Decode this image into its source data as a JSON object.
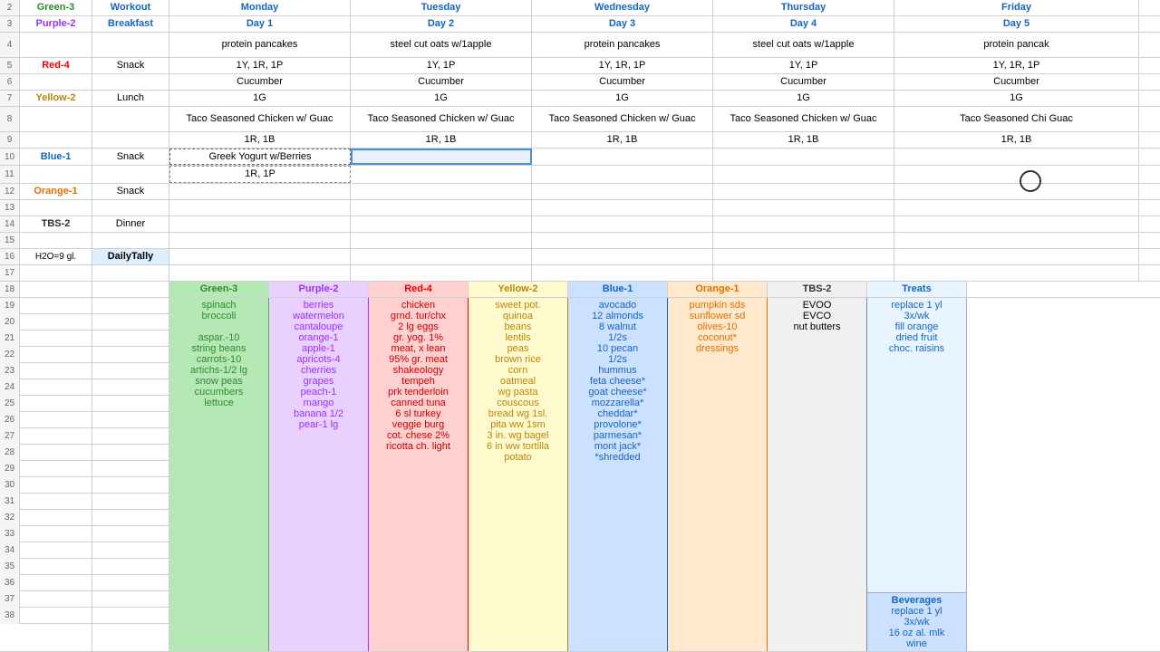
{
  "colors": {
    "green": "#2e8b2e",
    "purple": "#9b30ff",
    "red": "#cc0000",
    "yellow": "#b8860b",
    "blue": "#1565c0",
    "orange": "#e07000"
  },
  "rows": {
    "row2": {
      "num": "2",
      "a": "Green-3",
      "b": "Workout",
      "mon": "Monday",
      "tue": "Tuesday",
      "wed": "Wednesday",
      "thu": "Thursday",
      "fri": "Friday"
    },
    "row3": {
      "num": "3",
      "a": "Purple-2",
      "b": "Breakfast",
      "mon": "Day 1",
      "tue": "Day 2",
      "wed": "Day 3",
      "thu": "Day 4",
      "fri": "Day 5"
    },
    "row4": {
      "num": "4",
      "a": "",
      "b": "",
      "mon": "protein pancakes",
      "tue": "steel cut oats w/1apple",
      "wed": "protein pancakes",
      "thu": "steel cut oats w/1apple",
      "fri": "protein pancak"
    },
    "row5": {
      "num": "5",
      "a": "Red-4",
      "b": "Snack",
      "mon": "1Y, 1R, 1P",
      "tue": "1Y, 1P",
      "wed": "1Y, 1R, 1P",
      "thu": "1Y, 1P",
      "fri": "1Y, 1R, 1P"
    },
    "row6": {
      "num": "6",
      "a": "",
      "b": "",
      "mon": "Cucumber",
      "tue": "Cucumber",
      "wed": "Cucumber",
      "thu": "Cucumber",
      "fri": "Cucumber"
    },
    "row7": {
      "num": "7",
      "a": "Yellow-2",
      "b": "Lunch",
      "mon": "1G",
      "tue": "1G",
      "wed": "1G",
      "thu": "1G",
      "fri": "1G"
    },
    "row8": {
      "num": "8",
      "a": "",
      "b": "",
      "mon": "Taco Seasoned Chicken w/ Guac",
      "tue": "Taco Seasoned Chicken w/ Guac",
      "wed": "Taco Seasoned Chicken w/ Guac",
      "thu": "Taco Seasoned Chicken w/ Guac",
      "fri": "Taco Seasoned Chi Guac"
    },
    "row9": {
      "num": "9",
      "a": "",
      "b": "",
      "mon": "1R, 1B",
      "tue": "1R, 1B",
      "wed": "1R, 1B",
      "thu": "1R, 1B",
      "fri": "1R, 1B"
    },
    "row10": {
      "num": "10",
      "a": "Blue-1",
      "b": "Snack",
      "mon": "Greek Yogurt w/Berries",
      "tue": "",
      "wed": "",
      "thu": "",
      "fri": ""
    },
    "row11": {
      "num": "11",
      "a": "",
      "b": "",
      "mon": "1R, 1P",
      "tue": "",
      "wed": "",
      "thu": "",
      "fri": ""
    },
    "row12": {
      "num": "12",
      "a": "Orange-1",
      "b": "Snack",
      "mon": "",
      "tue": "",
      "wed": "",
      "thu": "",
      "fri": ""
    },
    "row13": {
      "num": "13",
      "a": "",
      "b": "",
      "mon": "",
      "tue": "",
      "wed": "",
      "thu": "",
      "fri": ""
    },
    "row14": {
      "num": "14",
      "a": "TBS-2",
      "b": "Dinner",
      "mon": "",
      "tue": "",
      "wed": "",
      "thu": "",
      "fri": ""
    },
    "row15": {
      "num": "15",
      "a": "",
      "b": "",
      "mon": "",
      "tue": "",
      "wed": "",
      "thu": "",
      "fri": ""
    },
    "row16": {
      "num": "16",
      "a": "H2O=9 gl.",
      "b": "DailyTally",
      "mon": "",
      "tue": "",
      "wed": "",
      "thu": "",
      "fri": ""
    }
  },
  "bottom": {
    "row18_green": "Green-3",
    "row18_purple": "Purple-2",
    "row18_red": "Red-4",
    "row18_yellow": "Yellow-2",
    "row18_blue": "Blue-1",
    "row18_orange": "Orange-1",
    "row18_tbs": "TBS-2",
    "row18_treats": "Treats",
    "green_items": "spinach\nbroccoli\naspar.-10\nstring beans\ncarrots-10\nartichs-1/2 lg\nsnow peas\ncucumbers\nlettuce",
    "purple_items": "berries\nwatermelon\ncantaloupe\norange-1\napple-1\napricots-4\ncherries\ngrapes\npeach-1\nmango\nbanana 1/2\npear-1 lg",
    "red_items": "chicken\ngrnd. tur/chx\n2 lg eggs\ngr. yog. 1%\nmeat, x lean\n95% gr. meat\nshakeology\ntempeh\nprk tenderloin\ncanned tuna\n6 sl turkey\nveggie burg\ncot. chese 2%\nricotta ch. light",
    "yellow_items": "sweet pot.\nquinoa\nbeans\nlentils\npeas\nbrown rice\ncorn\noatmeal\nwg pasta\ncouscous\nbread wg 1sl.\npita ww 1sm\n3 in. wg bagel\n6 in ww tortilla\npotato",
    "blue_items": "avocado\n12 almonds\n8 walnut\n1/2s\n10 pecan\n1/2s\nhummus\nfeta cheese*\ngoat cheese*\nmozzarella*\ncheddar*\nprovolone*\nparmesan*\nmont jack*\n*shredded",
    "orange_items": "pumpkin sds\nsunflower sd\nolives-10\ncoconut*\ndressings",
    "tbs_items": "EVOO\nEVCO\nnut butters",
    "treats_items": "replace 1 yl\n3x/wk\nfill orange\ndried fruit\nchoc. raisins",
    "bev_header": "Beverages",
    "bev_items": "replace 1 yl\n3x/wk\n16 oz al. mlk\nwine"
  },
  "row_numbers": [
    "2",
    "3",
    "4",
    "5",
    "6",
    "7",
    "8",
    "9",
    "10",
    "11",
    "12",
    "13",
    "14",
    "15",
    "16",
    "17",
    "18",
    "19",
    "20",
    "21",
    "22",
    "23",
    "24",
    "25",
    "26",
    "27",
    "28",
    "29",
    "30",
    "31",
    "32",
    "33",
    "34",
    "35",
    "36",
    "37",
    "38"
  ]
}
